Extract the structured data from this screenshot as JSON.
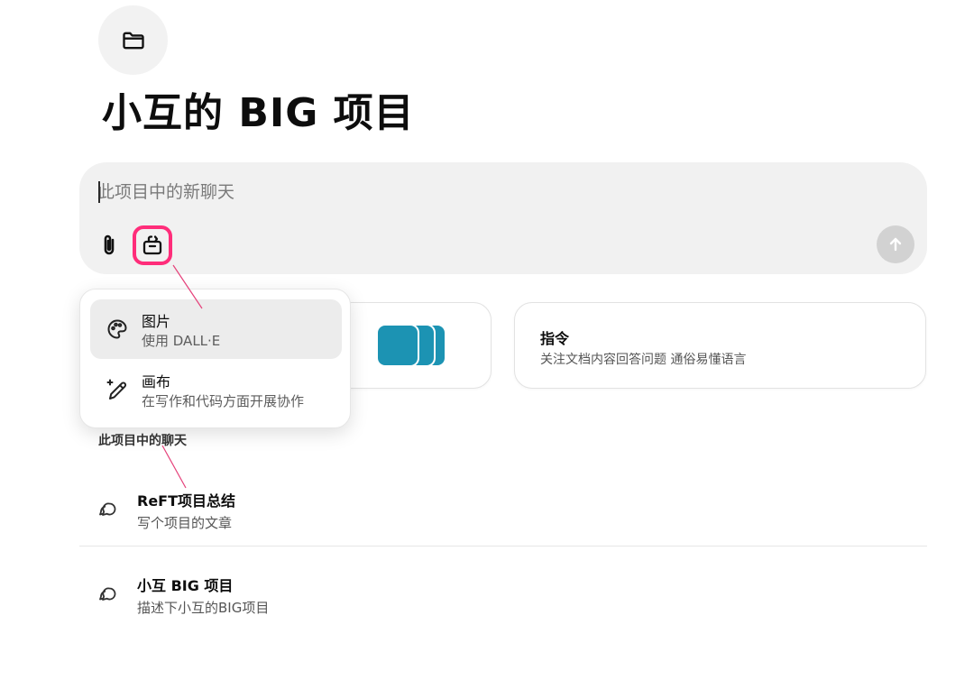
{
  "project": {
    "folder_icon": "folder-icon",
    "title": "小互的 BIG 项目"
  },
  "composer": {
    "placeholder": "此项目中的新聊天",
    "attach_icon": "paperclip-icon",
    "tools_icon": "toolbox-icon",
    "send_icon": "arrow-up-icon"
  },
  "tools_menu": {
    "items": [
      {
        "icon": "palette-icon",
        "title": "图片",
        "subtitle": "使用 DALL·E",
        "highlighted": true
      },
      {
        "icon": "pencil-sparkle-icon",
        "title": "画布",
        "subtitle": "在写作和代码方面开展协作",
        "highlighted": false
      }
    ]
  },
  "cards": {
    "files": {
      "tile_color": "#1c93b3",
      "tile_count": 3
    },
    "instructions": {
      "title": "指令",
      "description": "关注文档内容回答问题 通俗易懂语言"
    }
  },
  "chats": {
    "section_label": "此项目中的聊天",
    "items": [
      {
        "icon": "chat-bubbles-icon",
        "title": "ReFT项目总结",
        "subtitle": "写个项目的文章"
      },
      {
        "icon": "chat-bubbles-icon",
        "title": "小互 BIG 项目",
        "subtitle": "描述下小互的BIG项目"
      }
    ]
  },
  "colors": {
    "highlight": "#ff2d7a",
    "composer_bg": "#f1f1f1",
    "send_disabled": "#d2d2d2"
  }
}
